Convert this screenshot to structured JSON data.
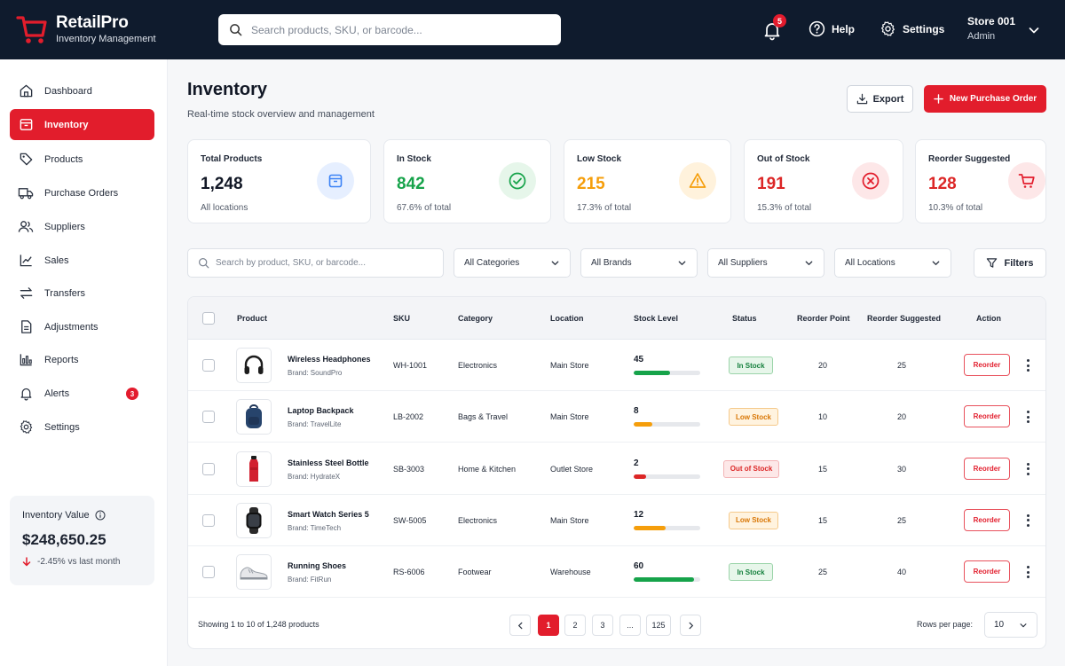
{
  "app": {
    "name": "RetailPro",
    "subtitle": "Inventory Management",
    "brand_color": "#e21d2c",
    "topbar_color": "#0f1b2d"
  },
  "topbar": {
    "search_placeholder": "Search products, SKU, or barcode...",
    "notification_count": "5",
    "help_label": "Help",
    "settings_label": "Settings",
    "store_name": "Store 001",
    "store_role": "Admin"
  },
  "sidebar": {
    "items": [
      {
        "label": "Dashboard",
        "icon": "home-icon"
      },
      {
        "label": "Inventory",
        "icon": "box-icon",
        "active": true
      },
      {
        "label": "Products",
        "icon": "tag-icon"
      },
      {
        "label": "Purchase Orders",
        "icon": "truck-icon"
      },
      {
        "label": "Suppliers",
        "icon": "users-icon"
      },
      {
        "label": "Sales",
        "icon": "chart-line-icon"
      },
      {
        "label": "Transfers",
        "icon": "transfer-icon"
      },
      {
        "label": "Adjustments",
        "icon": "document-icon"
      },
      {
        "label": "Reports",
        "icon": "bar-chart-icon"
      },
      {
        "label": "Alerts",
        "icon": "bell-icon",
        "badge": "3"
      },
      {
        "label": "Settings",
        "icon": "gear-icon"
      }
    ],
    "inventory_value": {
      "title": "Inventory Value",
      "value": "$248,650.25",
      "change": "-2.45% vs last month"
    }
  },
  "main": {
    "title": "Inventory",
    "subtitle": "Real-time stock overview and management",
    "export_label": "Export",
    "new_po_label": "New Purchase Order"
  },
  "stats": [
    {
      "label": "Total Products",
      "value": "1,248",
      "sub": "All locations",
      "color": "#121826",
      "icon": "box-icon",
      "icon_bg": "#e6efff",
      "icon_color": "#3b82f6"
    },
    {
      "label": "In Stock",
      "value": "842",
      "sub": "67.6% of total",
      "color": "#16a34a",
      "icon": "check-circle-icon",
      "icon_bg": "#e6f6ea",
      "icon_color": "#16a34a"
    },
    {
      "label": "Low Stock",
      "value": "215",
      "sub": "17.3% of total",
      "color": "#f59e0b",
      "icon": "warning-icon",
      "icon_bg": "#fff2dc",
      "icon_color": "#f59e0b"
    },
    {
      "label": "Out of Stock",
      "value": "191",
      "sub": "15.3% of total",
      "color": "#dc2626",
      "icon": "x-circle-icon",
      "icon_bg": "#fde7e8",
      "icon_color": "#e21d2c"
    },
    {
      "label": "Reorder Suggested",
      "value": "128",
      "sub": "10.3% of total",
      "color": "#dc2626",
      "icon": "cart-icon",
      "icon_bg": "#fde7e8",
      "icon_color": "#e21d2c"
    }
  ],
  "filters": {
    "search_placeholder": "Search by product, SKU, or barcode...",
    "category": "All Categories",
    "brand": "All Brands",
    "supplier": "All Suppliers",
    "location": "All Locations",
    "filters_label": "Filters"
  },
  "table": {
    "headers": {
      "product": "Product",
      "sku": "SKU",
      "category": "Category",
      "location": "Location",
      "stock": "Stock Level",
      "status": "Status",
      "reorder_point": "Reorder Point",
      "reorder_suggested": "Reorder Suggested",
      "action": "Action"
    },
    "rows": [
      {
        "name": "Wireless Headphones",
        "brand": "Brand: SoundPro",
        "sku": "WH-1001",
        "category": "Electronics",
        "location": "Main Store",
        "stock": "45",
        "stock_fraction": 0.55,
        "status": "In Stock",
        "status_kind": "in",
        "reorder_point": "20",
        "reorder_suggested": "25",
        "action": "Reorder",
        "thumb": "headphones-icon"
      },
      {
        "name": "Laptop Backpack",
        "brand": "Brand: TravelLite",
        "sku": "LB-2002",
        "category": "Bags & Travel",
        "location": "Main Store",
        "stock": "8",
        "stock_fraction": 0.28,
        "status": "Low Stock",
        "status_kind": "low",
        "reorder_point": "10",
        "reorder_suggested": "20",
        "action": "Reorder",
        "thumb": "backpack-icon"
      },
      {
        "name": "Stainless Steel Bottle",
        "brand": "Brand: HydrateX",
        "sku": "SB-3003",
        "category": "Home & Kitchen",
        "location": "Outlet Store",
        "stock": "2",
        "stock_fraction": 0.18,
        "status": "Out of Stock",
        "status_kind": "out",
        "reorder_point": "15",
        "reorder_suggested": "30",
        "action": "Reorder",
        "thumb": "bottle-icon"
      },
      {
        "name": "Smart Watch Series 5",
        "brand": "Brand: TimeTech",
        "sku": "SW-5005",
        "category": "Electronics",
        "location": "Main Store",
        "stock": "12",
        "stock_fraction": 0.48,
        "status": "Low Stock",
        "status_kind": "low",
        "reorder_point": "15",
        "reorder_suggested": "25",
        "action": "Reorder",
        "thumb": "watch-icon"
      },
      {
        "name": "Running Shoes",
        "brand": "Brand: FitRun",
        "sku": "RS-6006",
        "category": "Footwear",
        "location": "Warehouse",
        "stock": "60",
        "stock_fraction": 0.9,
        "status": "In Stock",
        "status_kind": "in",
        "reorder_point": "25",
        "reorder_suggested": "40",
        "action": "Reorder",
        "thumb": "shoe-icon"
      }
    ]
  },
  "pagination": {
    "showing": "Showing 1 to 10 of 1,248 products",
    "pages": [
      "1",
      "2",
      "3",
      "...",
      "125"
    ],
    "current": "1",
    "rows_per_page_label": "Rows per page:",
    "rows_per_page": "10"
  }
}
